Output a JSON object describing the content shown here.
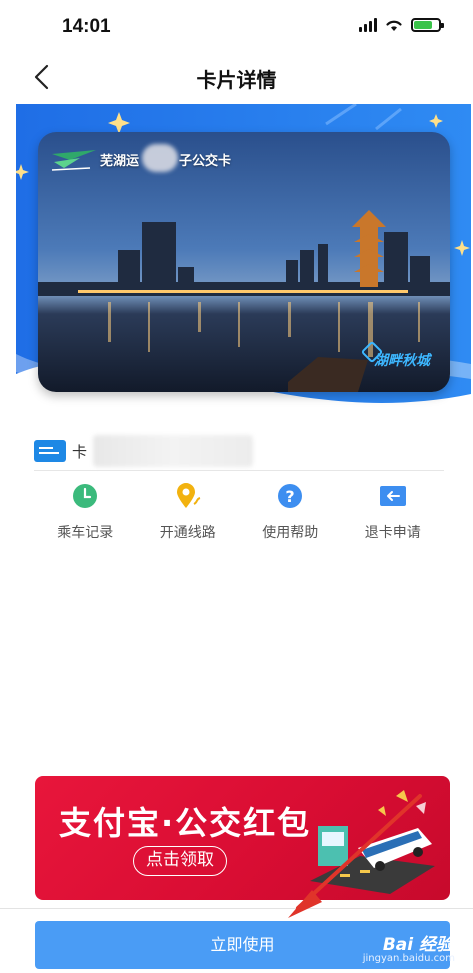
{
  "status_bar": {
    "time": "14:01",
    "battery_level": 0.75,
    "battery_color": "#3bc34a"
  },
  "nav": {
    "title": "卡片详情",
    "back_icon": "chevron-left-icon"
  },
  "card": {
    "name_left": "芜湖运",
    "name_right": "子公交卡",
    "watermark": "湖畔秋城",
    "logo_icon": "wave-logo-icon"
  },
  "card_number": {
    "label": "卡"
  },
  "menu": [
    {
      "label": "乘车记录",
      "icon": "clock-icon",
      "color": "#3bba7c"
    },
    {
      "label": "开通线路",
      "icon": "location-pin-icon",
      "color": "#f2b20f"
    },
    {
      "label": "使用帮助",
      "icon": "help-icon",
      "color": "#3d8ef0"
    },
    {
      "label": "退卡申请",
      "icon": "return-card-icon",
      "color": "#3d8ef0"
    }
  ],
  "promo": {
    "title": "支付宝·公交红包",
    "button": "点击领取",
    "bg_color": "#e8163b"
  },
  "footer": {
    "use_button": "立即使用",
    "button_color": "#4a9cf5",
    "watermark": "Bai 经验",
    "watermark_sub": "jingyan.baidu.com"
  },
  "theme": {
    "accent": "#1e88e5"
  }
}
